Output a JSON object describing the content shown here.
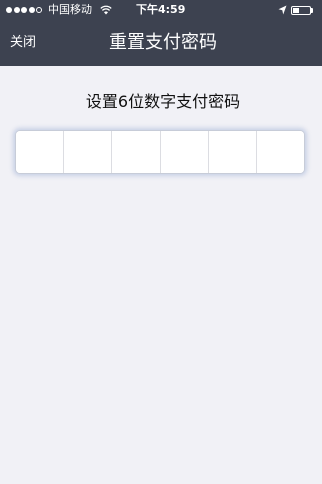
{
  "status_bar": {
    "carrier": "中国移动",
    "time": "下午4:59",
    "signal_bars_filled": 4,
    "signal_bars_total": 5,
    "battery_level": 0.35,
    "icons": [
      "signal-dots",
      "wifi-icon",
      "location-arrow-icon",
      "battery-icon"
    ]
  },
  "nav": {
    "close_label": "关闭",
    "title": "重置支付密码"
  },
  "content": {
    "prompt": "设置6位数字支付密码",
    "password_digits": [
      "",
      "",
      "",
      "",
      "",
      ""
    ]
  },
  "colors": {
    "header_bg": "#3d4250",
    "page_bg": "#f1f1f6",
    "text_dark": "#111111"
  }
}
